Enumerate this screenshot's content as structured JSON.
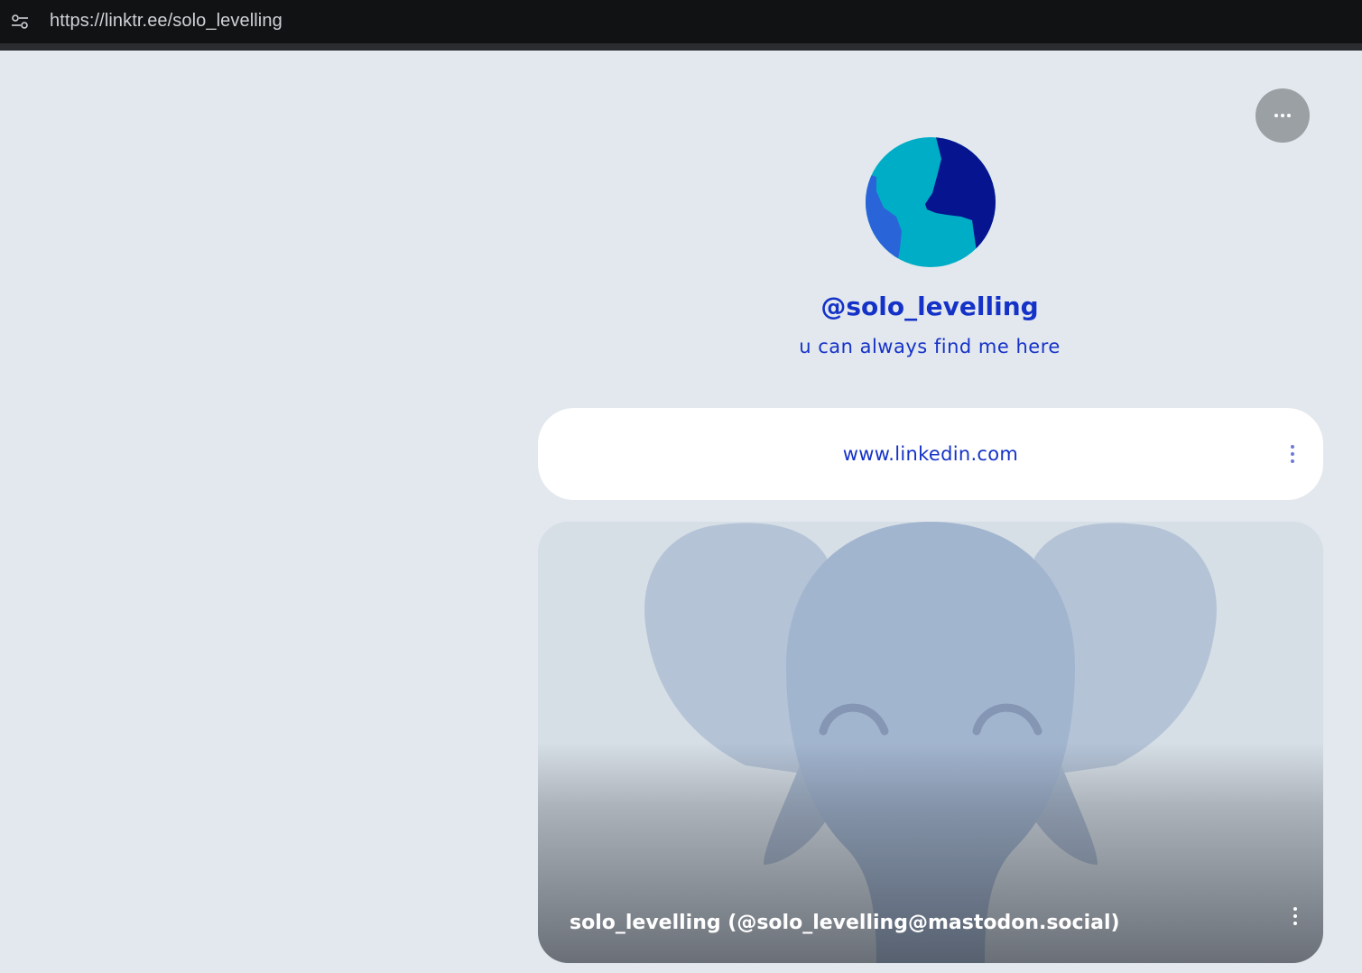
{
  "browser": {
    "url": "https://linktr.ee/solo_levelling",
    "site_settings_icon": "tune-icon"
  },
  "profile": {
    "name": "@solo_levelling",
    "bio": "u can always find me here",
    "avatar_colors": [
      "#00adc6",
      "#06148f",
      "#2964d8"
    ]
  },
  "more_button": {
    "icon": "ellipsis-icon"
  },
  "links": [
    {
      "label": "www.linkedin.com",
      "menu_icon": "kebab-menu-icon"
    }
  ],
  "media_card": {
    "title": "solo_levelling (@solo_levelling@mastodon.social)",
    "image": "elephant-mascot",
    "menu_icon": "kebab-menu-icon"
  },
  "colors": {
    "background": "#e2e8ee",
    "accent": "#1532c8",
    "card": "#ffffff"
  }
}
